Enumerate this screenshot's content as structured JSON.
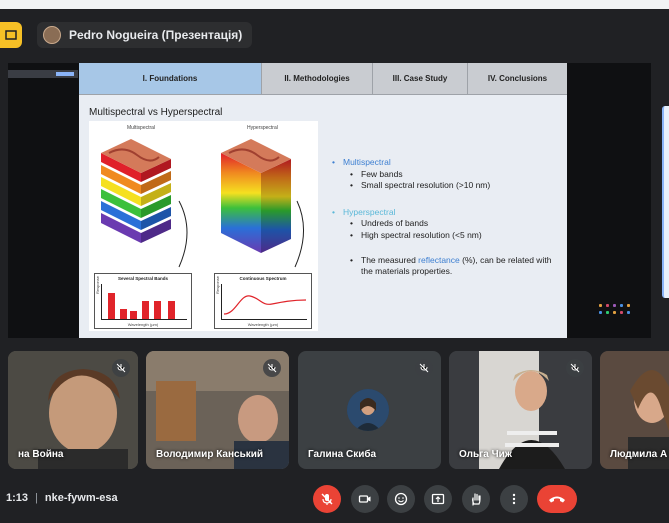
{
  "header": {
    "presenter_label": "Pedro Nogueira (Презентація)"
  },
  "slide": {
    "tabs": [
      {
        "label": "I. Foundations",
        "active": true
      },
      {
        "label": "II. Methodologies",
        "active": false
      },
      {
        "label": "III. Case Study",
        "active": false
      },
      {
        "label": "IV. Conclusions",
        "active": false
      }
    ],
    "title": "Multispectral vs Hyperspectral",
    "figure": {
      "left_caption": "Multispectral",
      "right_caption": "Hyperspectral",
      "left_chart_title": "Several Spectral Bands",
      "right_chart_title": "Continuous Spectrum",
      "x_axis_label": "Wavelength (µm)",
      "y_axis_label": "Response"
    },
    "bullets": {
      "multi_heading": "Multispectral",
      "multi_items": [
        "Few bands",
        "Small spectral resolution (>10 nm)"
      ],
      "hyper_heading": "Hyperspectral",
      "hyper_items": [
        "Undreds of bands",
        "High spectral resolution (<5 nm)"
      ],
      "note_prefix": "The measured ",
      "note_keyword": "reflectance",
      "note_suffix": " (%), can be related with the materials properties."
    }
  },
  "participants": [
    {
      "name": "на Война",
      "muted": true
    },
    {
      "name": "Володимир Канський",
      "muted": true
    },
    {
      "name": "Галина Скиба",
      "muted": true
    },
    {
      "name": "Ольга Чиж",
      "muted": true
    },
    {
      "name": "Людмила А",
      "muted": false
    }
  ],
  "footer": {
    "time": "1:13",
    "meeting_code": "nke-fywm-esa"
  },
  "colors": {
    "accent_red": "#ea4335",
    "tab_active": "#a7c7e7",
    "bullet_blue": "#3d7fd1",
    "bullet_cyan": "#5ab8d8",
    "bar_red": "#e0242a"
  },
  "icons": [
    "mic-off-icon",
    "camera-icon",
    "emoji-icon",
    "present-icon",
    "raise-hand-icon",
    "more-icon",
    "hang-up-icon"
  ]
}
